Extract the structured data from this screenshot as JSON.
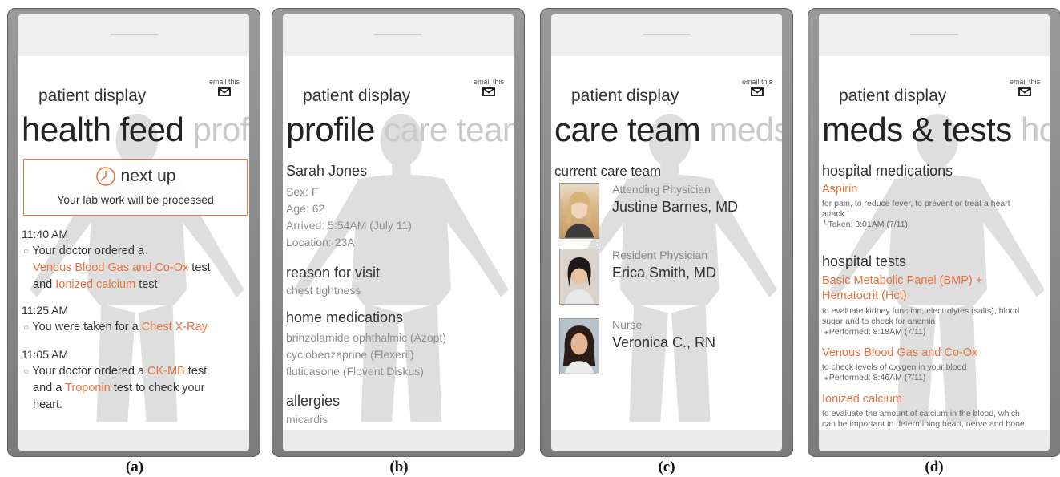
{
  "colors": {
    "accent": "#e8733d",
    "next_pivot": "#c9c9c9"
  },
  "screens": [
    {
      "caption": "(a)",
      "app_title": "patient display",
      "email_label": "email this",
      "pivot_title": "health feed",
      "pivot_next": "prof",
      "next_up": {
        "title": "next up",
        "message": "Your lab work will be processed"
      },
      "feed": [
        {
          "time": "11:40 AM",
          "line1": "Your doctor ordered a",
          "link1": "Venous Blood Gas and Co-Ox",
          "mid": " test",
          "line3a": "and ",
          "link2": "Ionized calcium",
          "line3b": " test"
        },
        {
          "time": "11:25 AM",
          "text": "You were taken for a ",
          "link": "Chest X-Ray"
        },
        {
          "time": "11:05 AM",
          "text1": "Your doctor ordered a ",
          "link1": "CK-MB",
          "text2": " test",
          "text3": "and a ",
          "link2": "Troponin",
          "text4": " test to check your",
          "text5": "heart."
        }
      ]
    },
    {
      "caption": "(b)",
      "app_title": "patient display",
      "email_label": "email this",
      "pivot_title": "profile",
      "pivot_next": "care tean",
      "name": "Sarah Jones",
      "details": [
        "Sex: F",
        "Age: 62",
        "Arrived: 5:54AM (July 11)",
        "Location: 23A"
      ],
      "reason_heading": "reason for visit",
      "reason": "chest tightness",
      "home_meds_heading": "home medications",
      "home_meds": [
        "brinzolamide ophthalmic (Azopt)",
        "cyclobenzaprine (Flexeril)",
        "fluticasone (Flovent Diskus)"
      ],
      "allergies_heading": "allergies",
      "allergies": "micardis"
    },
    {
      "caption": "(c)",
      "app_title": "patient display",
      "email_label": "email this",
      "pivot_title": "care team",
      "pivot_next": "meds",
      "section": "current care team",
      "members": [
        {
          "role": "Attending Physician",
          "name": "Justine Barnes, MD"
        },
        {
          "role": "Resident Physician",
          "name": "Erica Smith, MD"
        },
        {
          "role": "Nurse",
          "name": "Veronica C., RN"
        }
      ]
    },
    {
      "caption": "(d)",
      "app_title": "patient display",
      "email_label": "email this",
      "pivot_title": "meds & tests",
      "pivot_next": "hc",
      "meds_heading": "hospital medications",
      "med": {
        "name": "Aspirin",
        "desc1": "for pain, to reduce fever, to prevent or treat a heart",
        "desc2": "attack",
        "status": "└Taken: 8:01AM (7/11)"
      },
      "tests_heading": "hospital tests",
      "tests": [
        {
          "name1": "Basic Metabolic Panel (BMP) +",
          "name2": "Hematocrit (Hct)",
          "desc1": "to evaluate kidney function, electrolytes (salts), blood",
          "desc2": "sugar and to check for anemia",
          "status": "↳Performed: 8:18AM (7/11)"
        },
        {
          "name1": "Venous Blood Gas and Co-Ox",
          "desc1": "to check levels of oxygen in your blood",
          "status": "↳Performed: 8:46AM (7/11)"
        },
        {
          "name1": "Ionized calcium",
          "desc1": "to evaluate the amount of calcium in the blood, which",
          "desc2": "can be important in determining heart, nerve and bone"
        }
      ]
    }
  ]
}
